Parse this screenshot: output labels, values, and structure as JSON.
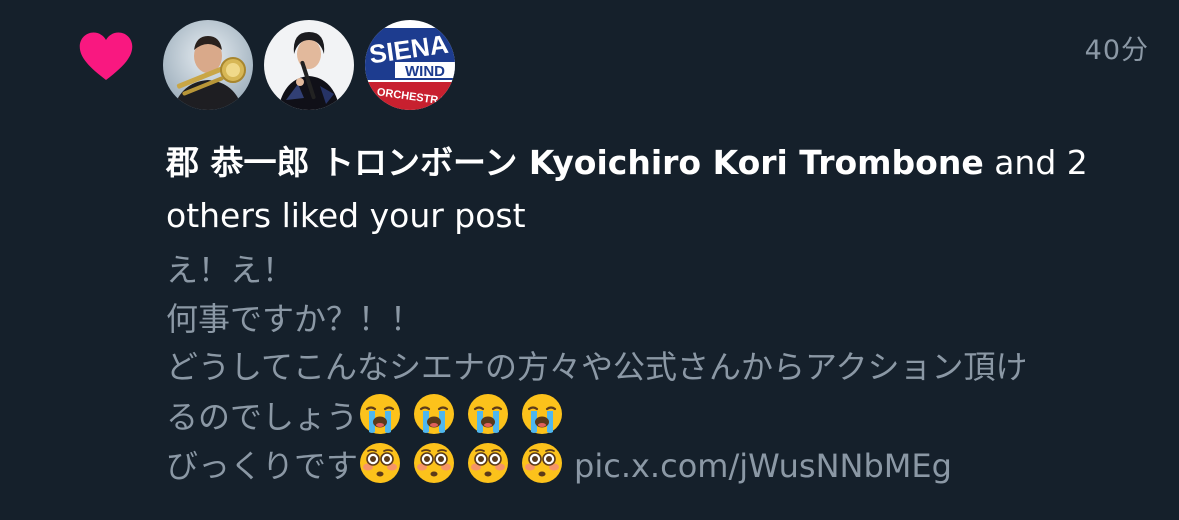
{
  "notification": {
    "type_icon": "heart-icon",
    "timestamp": "40分",
    "avatars": [
      {
        "name": "avatar-kyoichiro-kori",
        "icon": "trombone-player-photo"
      },
      {
        "name": "avatar-clarinet-player",
        "icon": "clarinet-player-photo"
      },
      {
        "name": "avatar-siena-wind-orchestra",
        "icon": "siena-wind-orchestra-logo"
      }
    ],
    "actor_name": "郡 恭一郎 トロンボーン Kyoichiro Kori Trombone",
    "action_text": " and 2 others liked your post",
    "post_lines": [
      "え！え！",
      "何事ですか？！！",
      "どうしてこんなシエナの方々や公式さんからアクション頂け",
      "るのでしょう",
      "びっくりです"
    ],
    "crying_emoji": "loudly-crying-face-emoji",
    "flushed_emoji": "flushed-face-emoji",
    "link_text": "pic.x.com/jWusNNbMEg"
  },
  "colors": {
    "background": "#15202b",
    "heart": "#f91880",
    "primary_text": "#ffffff",
    "secondary_text": "#8b98a5"
  }
}
